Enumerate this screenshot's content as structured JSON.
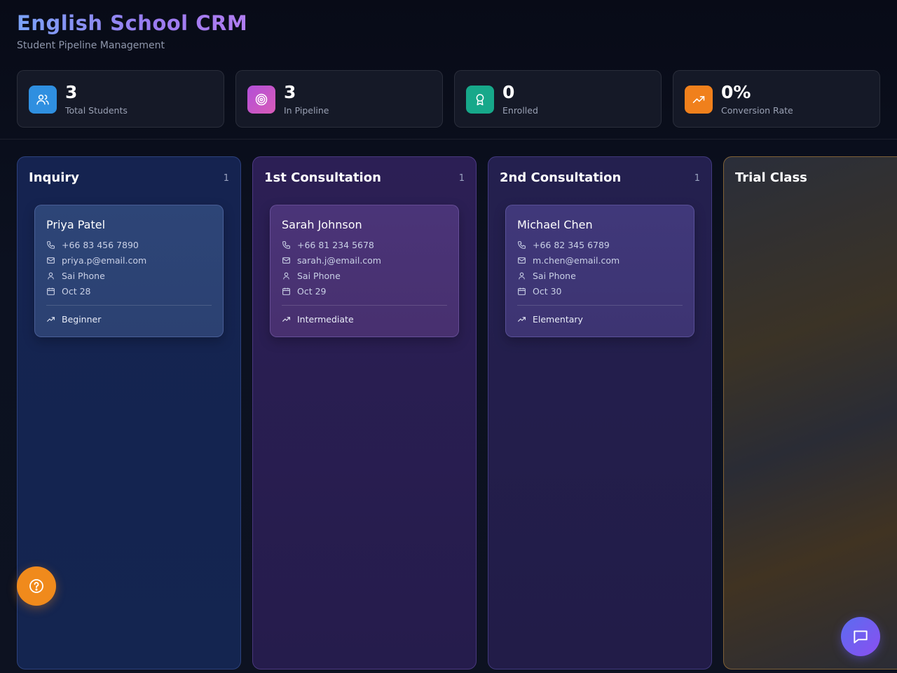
{
  "header": {
    "title": "English School CRM",
    "subtitle": "Student Pipeline Management"
  },
  "stats": [
    {
      "value": "3",
      "label": "Total Students",
      "icon": "users-icon",
      "color": "#2f8fe0"
    },
    {
      "value": "3",
      "label": "In Pipeline",
      "icon": "target-icon",
      "color": "#c04fd8"
    },
    {
      "value": "0",
      "label": "Enrolled",
      "icon": "award-icon",
      "color": "#17a88a"
    },
    {
      "value": "0%",
      "label": "Conversion Rate",
      "icon": "trending-up-icon",
      "color": "#f0801c"
    }
  ],
  "columns": [
    {
      "title": "Inquiry",
      "count": "1",
      "cards": [
        {
          "name": "Priya Patel",
          "phone": "+66 83 456 7890",
          "email": "priya.p@email.com",
          "assignee": "Sai Phone",
          "date": "Oct 28",
          "level": "Beginner"
        }
      ]
    },
    {
      "title": "1st Consultation",
      "count": "1",
      "cards": [
        {
          "name": "Sarah Johnson",
          "phone": "+66 81 234 5678",
          "email": "sarah.j@email.com",
          "assignee": "Sai Phone",
          "date": "Oct 29",
          "level": "Intermediate"
        }
      ]
    },
    {
      "title": "2nd Consultation",
      "count": "1",
      "cards": [
        {
          "name": "Michael Chen",
          "phone": "+66 82 345 6789",
          "email": "m.chen@email.com",
          "assignee": "Sai Phone",
          "date": "Oct 30",
          "level": "Elementary"
        }
      ]
    },
    {
      "title": "Trial Class",
      "count": "",
      "cards": []
    }
  ],
  "floating": {
    "help_icon": "help-circle-icon",
    "chat_icon": "message-square-icon"
  }
}
